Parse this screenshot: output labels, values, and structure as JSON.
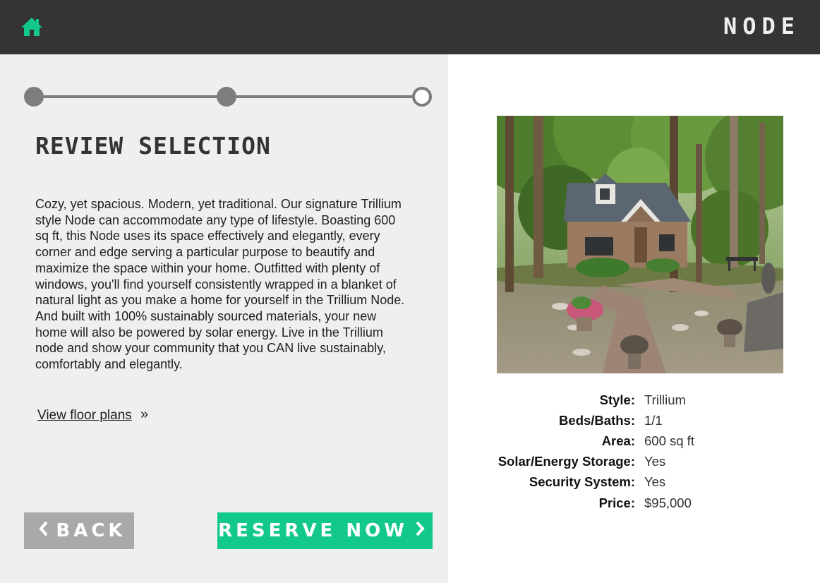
{
  "header": {
    "brand": "NODE",
    "home_icon": "home-icon",
    "accent": "#12c98b",
    "background": "#353432"
  },
  "progress": {
    "steps_total": 3,
    "current_step": 3
  },
  "review": {
    "title": "REVIEW SELECTION",
    "description": "Cozy, yet spacious. Modern, yet traditional. Our signature Trillium style Node can accommodate any type of lifestyle. Boasting 600 sq ft, this Node uses its space effectively and elegantly, every corner and edge serving a particular purpose to beautify and maximize the space within your home. Outfitted with plenty of windows, you'll find yourself consistently wrapped in a blanket of natural light as you make a home for yourself in the Trillium Node. And built with 100% sustainably sourced materials, your new home will also be powered by solar energy. Live in the Trillium node and show your community that you CAN live sustainably, comfortably and elegantly.",
    "floor_plans_link": "View floor plans",
    "floor_plans_icon": "double-chevron-right-icon"
  },
  "actions": {
    "back_label": "BACK",
    "back_icon": "chevron-left-icon",
    "reserve_label": "RESERVE NOW",
    "reserve_icon": "chevron-right-icon",
    "reserve_color": "#12c98b",
    "back_color": "#a9a9a9"
  },
  "specs": [
    {
      "label": "Style:",
      "value": "Trillium"
    },
    {
      "label": "Beds/Baths:",
      "value": "1/1"
    },
    {
      "label": "Area:",
      "value": "600 sq ft"
    },
    {
      "label": "Solar/Energy Storage:",
      "value": "Yes"
    },
    {
      "label": "Security System:",
      "value": "Yes"
    },
    {
      "label": "Price:",
      "value": "$95,000"
    }
  ]
}
